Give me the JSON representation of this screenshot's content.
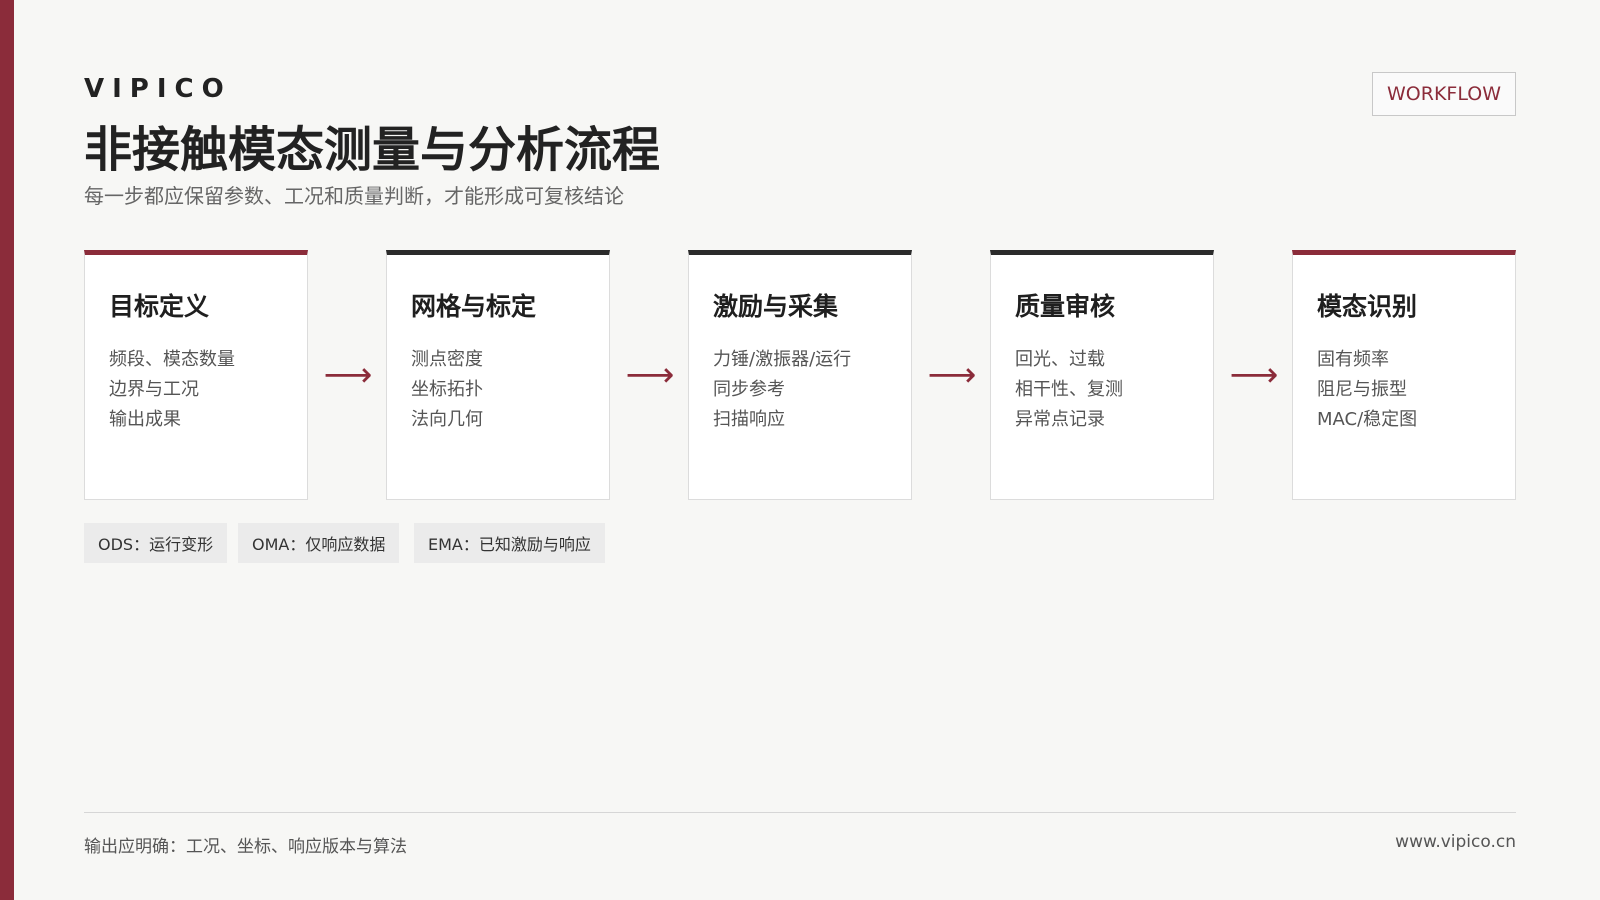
{
  "brand": "VIPICO",
  "title": "非接触模态测量与分析流程",
  "subtitle": "每一步都应保留参数、工况和质量判断，才能形成可复核结论",
  "badge": "WORKFLOW",
  "arrow_glyph": "⟶",
  "steps": [
    {
      "title": "目标定义",
      "items": [
        "频段、模态数量",
        "边界与工况",
        "输出成果"
      ]
    },
    {
      "title": "网格与标定",
      "items": [
        "测点密度",
        "坐标拓扑",
        "法向几何"
      ]
    },
    {
      "title": "激励与采集",
      "items": [
        "力锤/激振器/运行",
        "同步参考",
        "扫描响应"
      ]
    },
    {
      "title": "质量审核",
      "items": [
        "回光、过载",
        "相干性、复测",
        "异常点记录"
      ]
    },
    {
      "title": "模态识别",
      "items": [
        "固有频率",
        "阻尼与振型",
        "MAC/稳定图"
      ]
    }
  ],
  "tags": [
    "ODS：运行变形",
    "OMA：仅响应数据",
    "EMA：已知激励与响应"
  ],
  "footer": {
    "left": "输出应明确：工况、坐标、响应版本与算法",
    "right": "www.vipico.cn"
  },
  "colors": {
    "accent": "#8b2c3a",
    "dark": "#2b2b2b",
    "background": "#f7f7f5"
  }
}
